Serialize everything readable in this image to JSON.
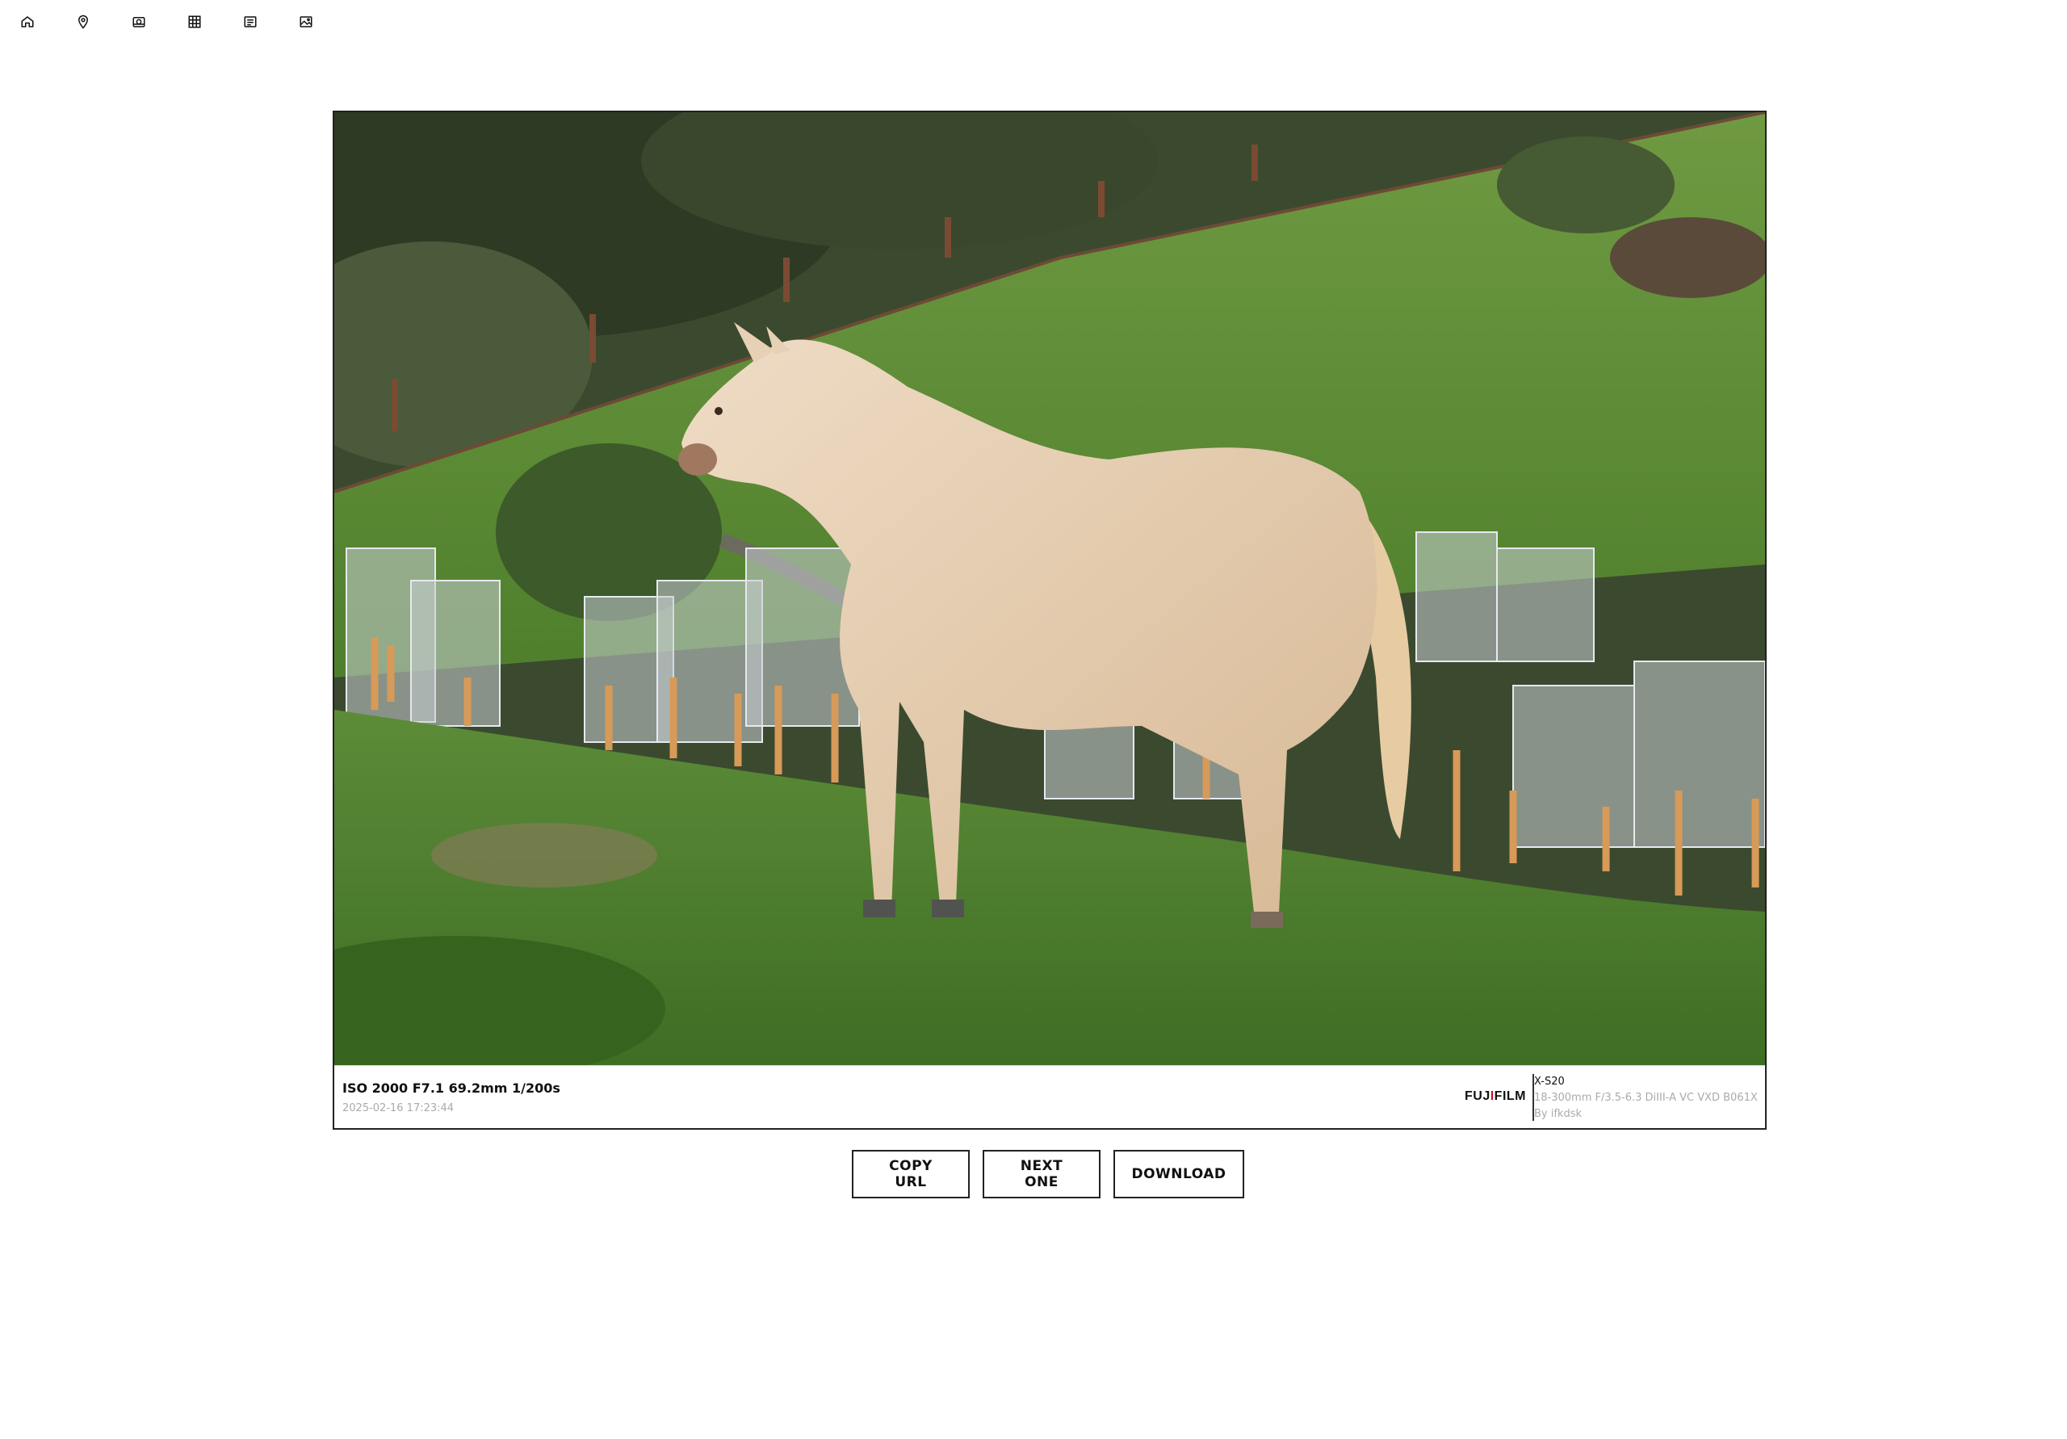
{
  "nav": {
    "items": [
      {
        "icon": "home-icon"
      },
      {
        "icon": "map-pin-icon"
      },
      {
        "icon": "camera-icon"
      },
      {
        "icon": "grid-icon"
      },
      {
        "icon": "list-icon"
      },
      {
        "icon": "image-icon"
      }
    ]
  },
  "photo": {
    "subject": "horse",
    "exif": "ISO 2000 F7.1 69.2mm 1/200s",
    "datetime": "2025-02-16 17:23:44",
    "brand_logo": "FUJIFILM",
    "camera_model": "X-S20",
    "lens": "18-300mm F/3.5-6.3 DiIII-A VC VXD B061X",
    "author": "By ifkdsk"
  },
  "actions": {
    "copy_url": "COPY URL",
    "next_one": "NEXT ONE",
    "download": "DOWNLOAD"
  },
  "colors": {
    "border": "#222222",
    "brand_red": "#c8102e"
  }
}
